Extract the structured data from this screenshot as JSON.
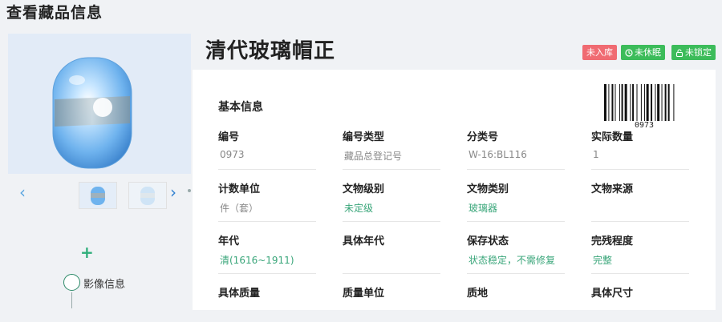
{
  "page": {
    "title": "查看藏品信息"
  },
  "relic": {
    "title": "清代玻璃帽正"
  },
  "badges": [
    {
      "label": "未入库",
      "color": "#f06b72",
      "icon": ""
    },
    {
      "label": "未休眠",
      "color": "#3cbc5a",
      "icon": "clock-icon"
    },
    {
      "label": "未锁定",
      "color": "#3cbc5a",
      "icon": "unlock-icon"
    }
  ],
  "barcode": {
    "text": "0973"
  },
  "info": {
    "section_title": "基本信息",
    "fields": [
      {
        "label": "编号",
        "value": "0973",
        "style": "gray"
      },
      {
        "label": "编号类型",
        "value": "藏品总登记号",
        "style": "gray"
      },
      {
        "label": "分类号",
        "value": "W-16:BL116",
        "style": "gray"
      },
      {
        "label": "实际数量",
        "value": "1",
        "style": "gray"
      },
      {
        "label": "计数单位",
        "value": "件（套）",
        "style": "gray"
      },
      {
        "label": "文物级别",
        "value": "未定级",
        "style": "green"
      },
      {
        "label": "文物类别",
        "value": "玻璃器",
        "style": "green"
      },
      {
        "label": "文物来源",
        "value": "",
        "style": "gray"
      },
      {
        "label": "年代",
        "value": "清(1616~1911)",
        "style": "green"
      },
      {
        "label": "具体年代",
        "value": "",
        "style": "gray"
      },
      {
        "label": "保存状态",
        "value": "状态稳定，不需修复",
        "style": "green"
      },
      {
        "label": "完残程度",
        "value": "完整",
        "style": "green"
      },
      {
        "label": "具体质量",
        "value": "",
        "style": "gray"
      },
      {
        "label": "质量单位",
        "value": "",
        "style": "gray"
      },
      {
        "label": "质地",
        "value": "",
        "style": "gray"
      },
      {
        "label": "具体尺寸",
        "value": "",
        "style": "gray"
      }
    ]
  },
  "timeline": {
    "items": [
      {
        "label": "影像信息"
      }
    ]
  },
  "colors": {
    "accent_green": "#2fae7a",
    "badge_red": "#f06b72",
    "badge_green": "#3cbc5a",
    "value_green": "#3aa67a"
  }
}
